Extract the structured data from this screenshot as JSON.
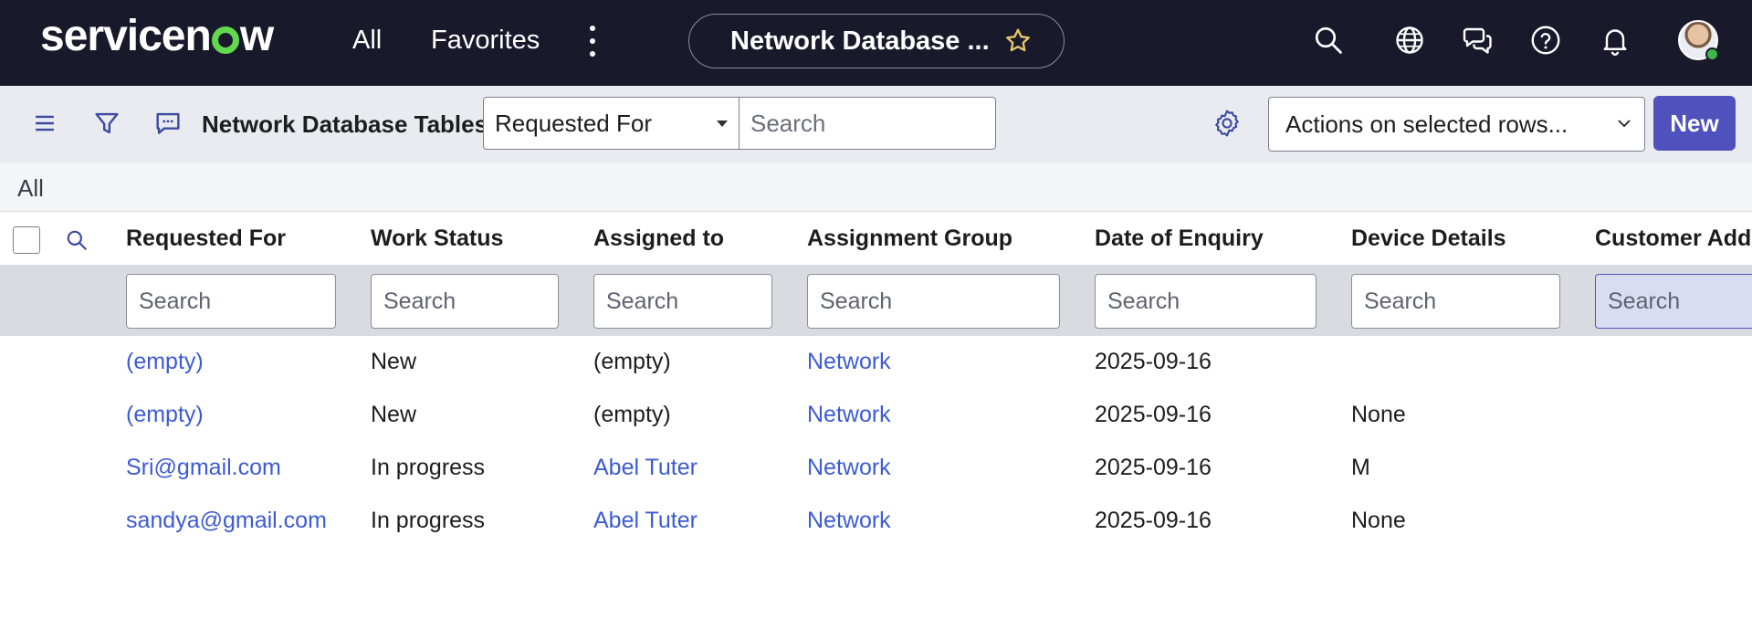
{
  "app": {
    "brand_prefix": "servicen",
    "brand_suffix": "w",
    "nav": {
      "all": "All",
      "favorites": "Favorites"
    },
    "page_pill_title": "Network Database ...",
    "colors": {
      "nav_bg": "#181a2b",
      "brand_green": "#62d84e",
      "primary": "#4f52bd",
      "link": "#3c5bd4"
    }
  },
  "toolbar": {
    "title": "Network Database Tables",
    "field_select": "Requested For",
    "search_placeholder": "Search",
    "actions_select": "Actions on selected rows...",
    "new_label": "New"
  },
  "breadcrumb": {
    "label": "All"
  },
  "table": {
    "columns": [
      "Requested For",
      "Work Status",
      "Assigned to",
      "Assignment Group",
      "Date of Enquiry",
      "Device Details",
      "Customer Addr"
    ],
    "filter_placeholder": "Search",
    "rows": [
      {
        "requested_for": "(empty)",
        "work_status": "New",
        "assigned_to": "(empty)",
        "assignment_group": "Network",
        "date": "2025-09-16",
        "device": ""
      },
      {
        "requested_for": "(empty)",
        "work_status": "New",
        "assigned_to": "(empty)",
        "assignment_group": "Network",
        "date": "2025-09-16",
        "device": "None"
      },
      {
        "requested_for": "Sri@gmail.com",
        "work_status": "In progress",
        "assigned_to": "Abel Tuter",
        "assignment_group": "Network",
        "date": "2025-09-16",
        "device": "M"
      },
      {
        "requested_for": "sandya@gmail.com",
        "work_status": "In progress",
        "assigned_to": "Abel Tuter",
        "assignment_group": "Network",
        "date": "2025-09-16",
        "device": "None"
      }
    ]
  },
  "icons": [
    "menu-icon",
    "filter-icon",
    "comment-icon",
    "star-icon",
    "search-icon",
    "globe-icon",
    "chat-icon",
    "help-icon",
    "bell-icon",
    "gear-icon",
    "chevron-down-icon"
  ]
}
